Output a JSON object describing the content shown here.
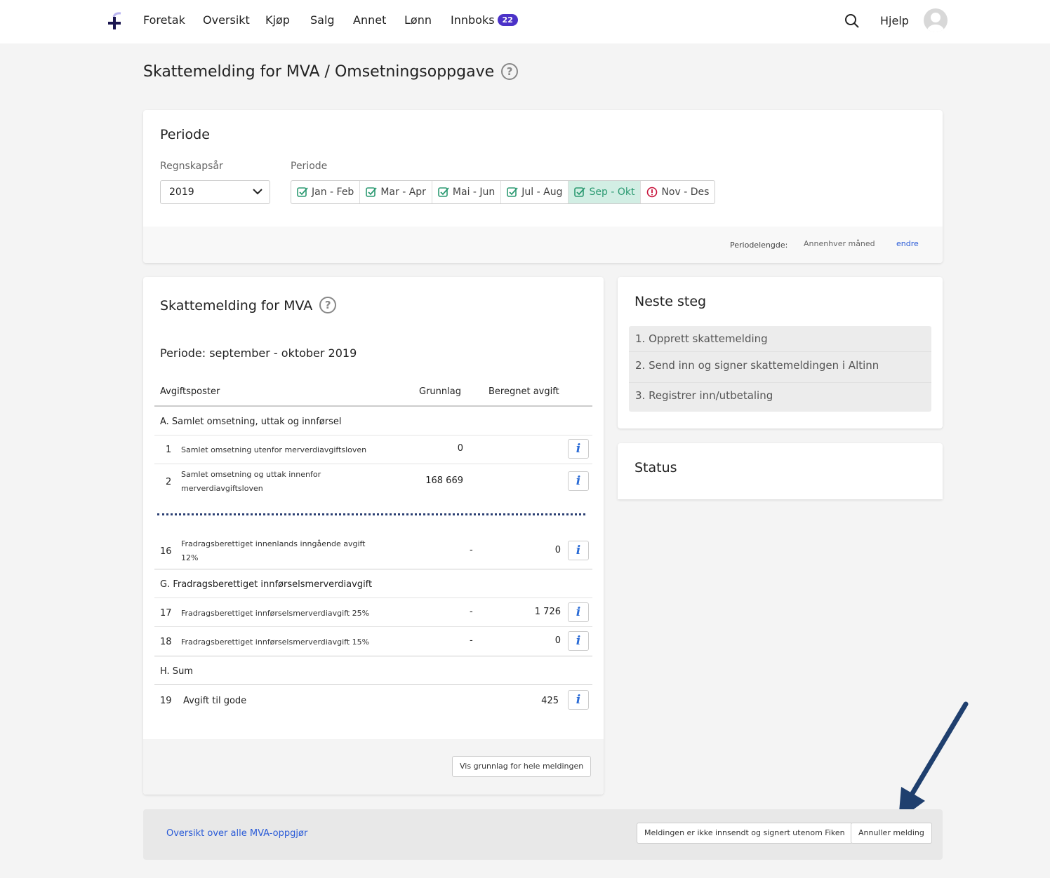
{
  "nav": {
    "items": [
      "Foretak",
      "Oversikt",
      "Kjøp",
      "Salg",
      "Annet",
      "Lønn",
      "Innboks"
    ],
    "inbox_count": "22",
    "help": "Hjelp"
  },
  "page": {
    "title": "Skattemelding for MVA / Omsetningsoppgave",
    "help_mark": "?"
  },
  "periode_card": {
    "title": "Periode",
    "year_label": "Regnskapsår",
    "year_value": "2019",
    "period_label": "Periode",
    "periods": [
      {
        "label": "Jan - Feb",
        "state": "done"
      },
      {
        "label": "Mar - Apr",
        "state": "done"
      },
      {
        "label": "Mai - Jun",
        "state": "done"
      },
      {
        "label": "Jul - Aug",
        "state": "done"
      },
      {
        "label": "Sep - Okt",
        "state": "active"
      },
      {
        "label": "Nov - Des",
        "state": "warning"
      }
    ],
    "length_label": "Periodelengde:",
    "length_value": "Annenhver måned",
    "change_link": "endre"
  },
  "skattemelding": {
    "title": "Skattemelding for MVA",
    "help_mark": "?",
    "period_text": "Periode: september - oktober 2019",
    "col_posts": "Avgiftsposter",
    "col_basis": "Grunnlag",
    "col_fee": "Beregnet avgift",
    "section_a": "A. Samlet omsetning, uttak og innførsel",
    "row1": {
      "num": "1",
      "label": "Samlet omsetning utenfor merverdiavgiftsloven",
      "basis": "0"
    },
    "row2": {
      "num": "2",
      "label1": "Samlet omsetning og uttak innenfor",
      "label2": "merverdiavgiftsloven",
      "basis": "168 669"
    },
    "row16": {
      "num": "16",
      "label1": "Fradragsberettiget innenlands inngående avgift",
      "label2": "12%",
      "basis": "-",
      "fee": "0"
    },
    "section_g": "G. Fradragsberettiget innførselsmerverdiavgift",
    "row17": {
      "num": "17",
      "label": "Fradragsberettiget innførselsmerverdiavgift 25%",
      "basis": "-",
      "fee": "1 726"
    },
    "row18": {
      "num": "18",
      "label": "Fradragsberettiget innførselsmerverdiavgift 15%",
      "basis": "-",
      "fee": "0"
    },
    "section_h": "H. Sum",
    "row19": {
      "num": "19",
      "label": "Avgift til gode",
      "fee": "425"
    },
    "info_glyph": "i",
    "show_all_button": "Vis grunnlag for hele meldingen"
  },
  "neste_steg": {
    "title": "Neste steg",
    "steps": [
      "1. Opprett skattemelding",
      "2. Send inn og signer skattemeldingen i Altinn",
      "3. Registrer inn/utbetaling"
    ]
  },
  "status": {
    "title": "Status"
  },
  "footer": {
    "overview_link": "Oversikt over alle MVA-oppgjør",
    "not_sent_button": "Meldingen er ikke innsendt og signert utenom Fiken",
    "cancel_button": "Annuller melding"
  },
  "colors": {
    "accent": "#4b32c8",
    "active_bg": "#d2eee4",
    "active_fg": "#2c9a72",
    "warn": "#c8143c",
    "link": "#2a5bd7",
    "arrow": "#1f3f6e"
  }
}
